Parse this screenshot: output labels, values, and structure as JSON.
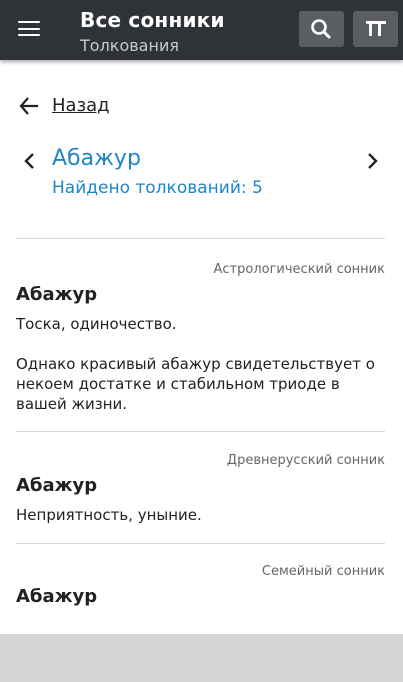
{
  "app_bar": {
    "title": "Все сонники",
    "subtitle": "Толкования",
    "menu_icon": "hamburger-menu-icon",
    "search_icon": "search-icon",
    "text_size_icon": "text-size-icon",
    "background": "#2f3337"
  },
  "back": {
    "label": "Назад",
    "icon": "arrow-left-icon"
  },
  "header": {
    "word": "Абажур",
    "found": "Найдено толкований: 5",
    "accent_color": "#1e86c8"
  },
  "entries": [
    {
      "source": "Астрологический сонник",
      "word": "Абажур",
      "paragraphs": [
        "Тоска, одиночество.",
        "Однако красивый абажур свидетельствует о некоем достатке и стабильном триоде в вашей жизни."
      ]
    },
    {
      "source": "Древнерусский сонник",
      "word": "Абажур",
      "paragraphs": [
        "Неприятность, уныние."
      ]
    },
    {
      "source": "Семейный сонник",
      "word": "Абажур",
      "paragraphs": []
    }
  ]
}
